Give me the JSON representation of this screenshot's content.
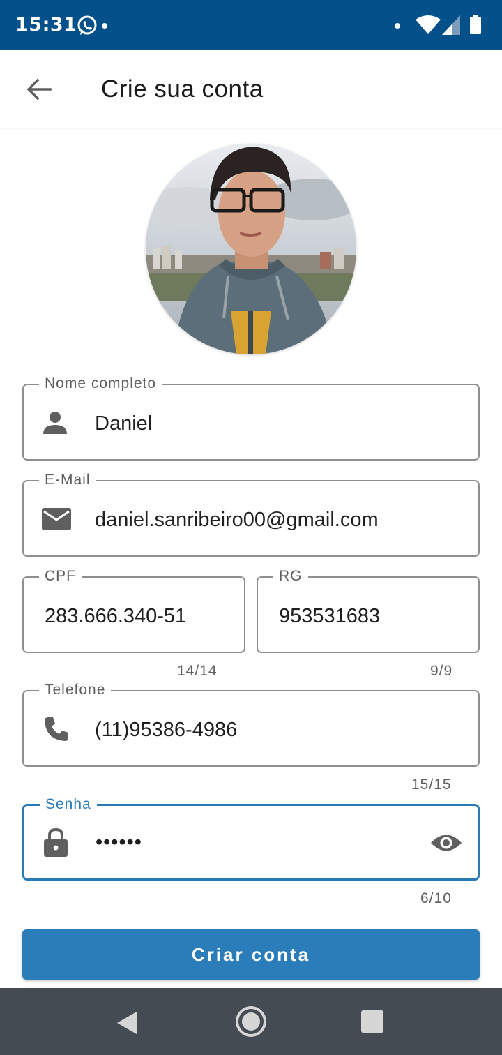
{
  "status_bar": {
    "time": "15:31",
    "icons": [
      "whatsapp-icon",
      "notification-dot",
      "wifi-icon",
      "signal-icon",
      "battery-icon"
    ]
  },
  "app_bar": {
    "title": "Crie sua conta",
    "back_icon": "arrow-back-icon"
  },
  "form": {
    "nome": {
      "label": "Nome completo",
      "value": "Daniel",
      "icon": "person-icon"
    },
    "email": {
      "label": "E-Mail",
      "value": "daniel.sanribeiro00@gmail.com",
      "icon": "mail-icon"
    },
    "cpf": {
      "label": "CPF",
      "value": "283.666.340-51",
      "counter": "14/14"
    },
    "rg": {
      "label": "RG",
      "value": "953531683",
      "counter": "9/9"
    },
    "telefone": {
      "label": "Telefone",
      "value": "(11)95386-4986",
      "counter": "15/15",
      "icon": "phone-icon"
    },
    "senha": {
      "label": "Senha",
      "value": "••••••",
      "counter": "6/10",
      "icon": "lock-icon",
      "toggle_icon": "eye-icon"
    }
  },
  "submit_label": "Criar conta",
  "nav_bar": {
    "icons": [
      "nav-back-icon",
      "nav-home-icon",
      "nav-recents-icon"
    ]
  },
  "colors": {
    "status_bar": "#03508b",
    "accent": "#2a7ab6",
    "button": "#2a7db9",
    "nav_bar": "#454b52",
    "outline": "#8f8f8f"
  }
}
